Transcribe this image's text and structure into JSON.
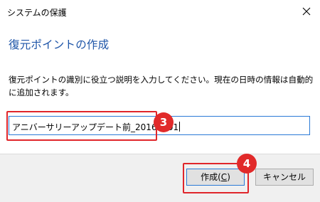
{
  "window": {
    "title": "システムの保護"
  },
  "heading": "復元ポイントの作成",
  "description": "復元ポイントの識別に役立つ説明を入力してください。現在の日時の情報は自動的に追加されます。",
  "input": {
    "value": "アニバーサリーアップデート前_20160801"
  },
  "badges": {
    "step3": "3",
    "step4": "4"
  },
  "buttons": {
    "create": {
      "label": "作成(",
      "mnemonic": "C",
      "suffix": ")"
    },
    "cancel": "キャンセル"
  },
  "colors": {
    "heading": "#1e55a8",
    "highlight": "#e0262b",
    "badge": "#e12a2a",
    "focus": "#2b7ad6"
  },
  "icons": {
    "close": "close-icon"
  }
}
